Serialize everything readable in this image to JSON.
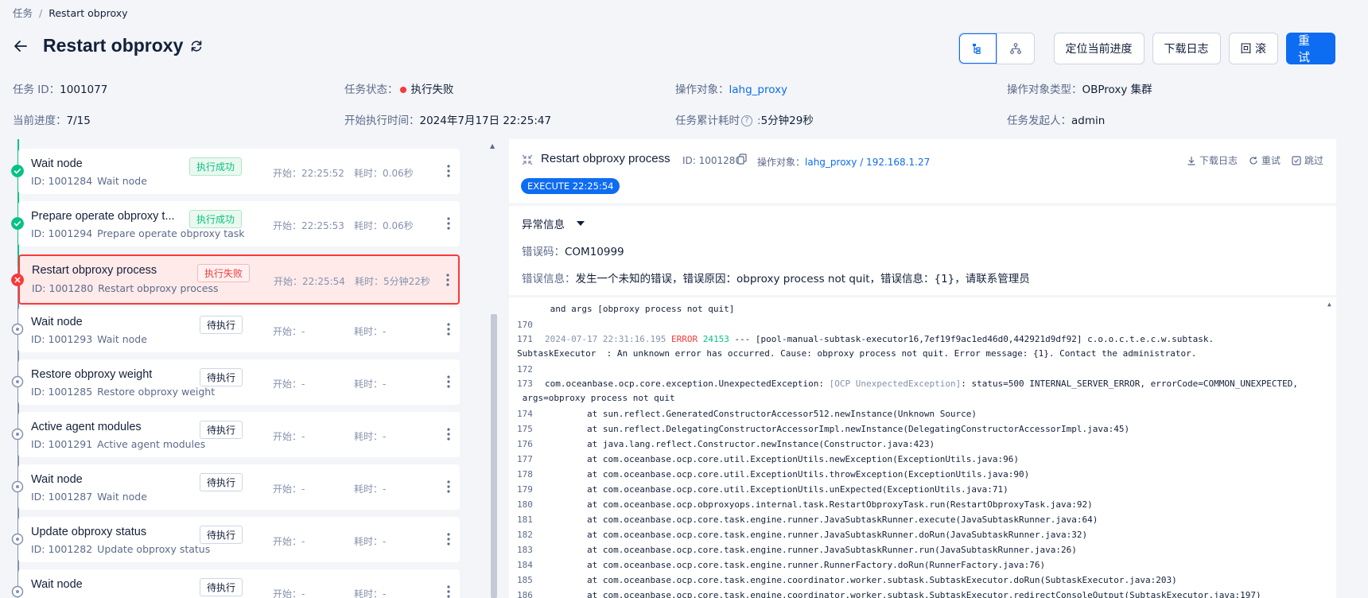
{
  "breadcrumb": {
    "root": "任务",
    "current": "Restart obproxy"
  },
  "header": {
    "title": "Restart obproxy"
  },
  "toolbar": {
    "locate": "定位当前进度",
    "download": "下载日志",
    "rollback": "回 滚",
    "retry": "重 试"
  },
  "meta": {
    "task_id_label": "任务 ID：",
    "task_id": "1001077",
    "status_label": "任务状态：",
    "status": "执行失败",
    "target_label": "操作对象：",
    "target": "lahg_proxy",
    "target_type_label": "操作对象类型：",
    "target_type": "OBProxy 集群",
    "progress_label": "当前进度：",
    "progress": "7/15",
    "start_label": "开始执行时间：",
    "start": "2024年7月17日 22:25:47",
    "elapsed_label": "任务累计耗时",
    "elapsed": "5分钟29秒",
    "initiator_label": "任务发起人：",
    "initiator": "admin"
  },
  "tasks": [
    {
      "name": "Wait node",
      "id": "ID: 1001284",
      "desc": "Wait node",
      "status": "执行成功",
      "start_label": "开始：",
      "start": "22:25:52",
      "dur_label": "耗时：",
      "dur": "0.06秒"
    },
    {
      "name": "Prepare operate obproxy t...",
      "id": "ID: 1001294",
      "desc": "Prepare operate obproxy task",
      "status": "执行成功",
      "start_label": "开始：",
      "start": "22:25:53",
      "dur_label": "耗时：",
      "dur": "0.06秒"
    },
    {
      "name": "Restart obproxy process",
      "id": "ID: 1001280",
      "desc": "Restart obproxy process",
      "status": "执行失败",
      "start_label": "开始：",
      "start": "22:25:54",
      "dur_label": "耗时：",
      "dur": "5分钟22秒"
    },
    {
      "name": "Wait node",
      "id": "ID: 1001293",
      "desc": "Wait node",
      "status": "待执行",
      "start_label": "开始：",
      "start": "-",
      "dur_label": "耗时：",
      "dur": "-"
    },
    {
      "name": "Restore obproxy weight",
      "id": "ID: 1001285",
      "desc": "Restore obproxy weight",
      "status": "待执行",
      "start_label": "开始：",
      "start": "-",
      "dur_label": "耗时：",
      "dur": "-"
    },
    {
      "name": "Active agent modules",
      "id": "ID: 1001291",
      "desc": "Active agent modules",
      "status": "待执行",
      "start_label": "开始：",
      "start": "-",
      "dur_label": "耗时：",
      "dur": "-"
    },
    {
      "name": "Wait node",
      "id": "ID: 1001287",
      "desc": "Wait node",
      "status": "待执行",
      "start_label": "开始：",
      "start": "-",
      "dur_label": "耗时：",
      "dur": "-"
    },
    {
      "name": "Update obproxy status",
      "id": "ID: 1001282",
      "desc": "Update obproxy status",
      "status": "待执行",
      "start_label": "开始：",
      "start": "-",
      "dur_label": "耗时：",
      "dur": "-"
    },
    {
      "name": "Wait node",
      "id": "",
      "desc": "",
      "status": "待执行",
      "start_label": "开始：",
      "start": "-",
      "dur_label": "耗时：",
      "dur": "-"
    }
  ],
  "detail": {
    "title": "Restart obproxy process",
    "id": "ID: 1001280",
    "target_label": "操作对象：",
    "target": "lahg_proxy / 192.168.1.27",
    "actions": {
      "download": "下载日志",
      "retry": "重试",
      "skip": "跳过"
    },
    "exec_badge": "EXECUTE 22:25:54",
    "error_title": "异常信息",
    "error_code_label": "错误码：",
    "error_code": "COM10999",
    "error_msg_label": "错误信息：",
    "error_msg": "发生一个未知的错误，错误原因：obproxy process not quit，错误信息：{1}，请联系管理员"
  },
  "log": {
    "l0": " and args [obproxy process not quit]",
    "l170": "170",
    "l171_n": "171",
    "l171_ts": "2024-07-17 22:31:16.195 ",
    "l171_lvl": "ERROR",
    "l171_pid": " 24153 ",
    "l171_rest": "--- [pool-manual-subtask-executor16,7ef19f9ac1ed46d0,442921d9df92] c.o.o.c.t.e.c.w.subtask.",
    "l171b": "SubtaskExecutor  : An unknown error has occurred. Cause: obproxy process not quit. Error message: {1}. Contact the administrator.",
    "l172": "172",
    "l173_n": "173",
    "l173_a": "com.oceanbase.ocp.core.exception.UnexpectedException: ",
    "l173_b": "[OCP UnexpectedException]",
    "l173_c": ": status=500 INTERNAL_SERVER_ERROR, errorCode=COMMON_UNEXPECTED,",
    "l173b": " args=obproxy process not quit",
    "frames": [
      {
        "n": "174",
        "t": "        at sun.reflect.GeneratedConstructorAccessor512.newInstance(Unknown Source)"
      },
      {
        "n": "175",
        "t": "        at sun.reflect.DelegatingConstructorAccessorImpl.newInstance(DelegatingConstructorAccessorImpl.java:45)"
      },
      {
        "n": "176",
        "t": "        at java.lang.reflect.Constructor.newInstance(Constructor.java:423)"
      },
      {
        "n": "177",
        "t": "        at com.oceanbase.ocp.core.util.ExceptionUtils.newException(ExceptionUtils.java:96)"
      },
      {
        "n": "178",
        "t": "        at com.oceanbase.ocp.core.util.ExceptionUtils.throwException(ExceptionUtils.java:90)"
      },
      {
        "n": "179",
        "t": "        at com.oceanbase.ocp.core.util.ExceptionUtils.unExpected(ExceptionUtils.java:71)"
      },
      {
        "n": "180",
        "t": "        at com.oceanbase.ocp.obproxyops.internal.task.RestartObproxyTask.run(RestartObproxyTask.java:92)"
      },
      {
        "n": "181",
        "t": "        at com.oceanbase.ocp.core.task.engine.runner.JavaSubtaskRunner.execute(JavaSubtaskRunner.java:64)"
      },
      {
        "n": "182",
        "t": "        at com.oceanbase.ocp.core.task.engine.runner.JavaSubtaskRunner.doRun(JavaSubtaskRunner.java:32)"
      },
      {
        "n": "183",
        "t": "        at com.oceanbase.ocp.core.task.engine.runner.JavaSubtaskRunner.run(JavaSubtaskRunner.java:26)"
      },
      {
        "n": "184",
        "t": "        at com.oceanbase.ocp.core.task.engine.runner.RunnerFactory.doRun(RunnerFactory.java:76)"
      },
      {
        "n": "185",
        "t": "        at com.oceanbase.ocp.core.task.engine.coordinator.worker.subtask.SubtaskExecutor.doRun(SubtaskExecutor.java:203)"
      },
      {
        "n": "186",
        "t": "        at com.oceanbase.ocp.core.task.engine.coordinator.worker.subtask.SubtaskExecutor.redirectConsoleOutput(SubtaskExecutor.java:197)"
      }
    ]
  },
  "colors": {
    "accent": "#0d6cf2",
    "success": "#0ac185",
    "error": "#f93939",
    "text": "#132039",
    "muted": "#5c6b8a"
  }
}
